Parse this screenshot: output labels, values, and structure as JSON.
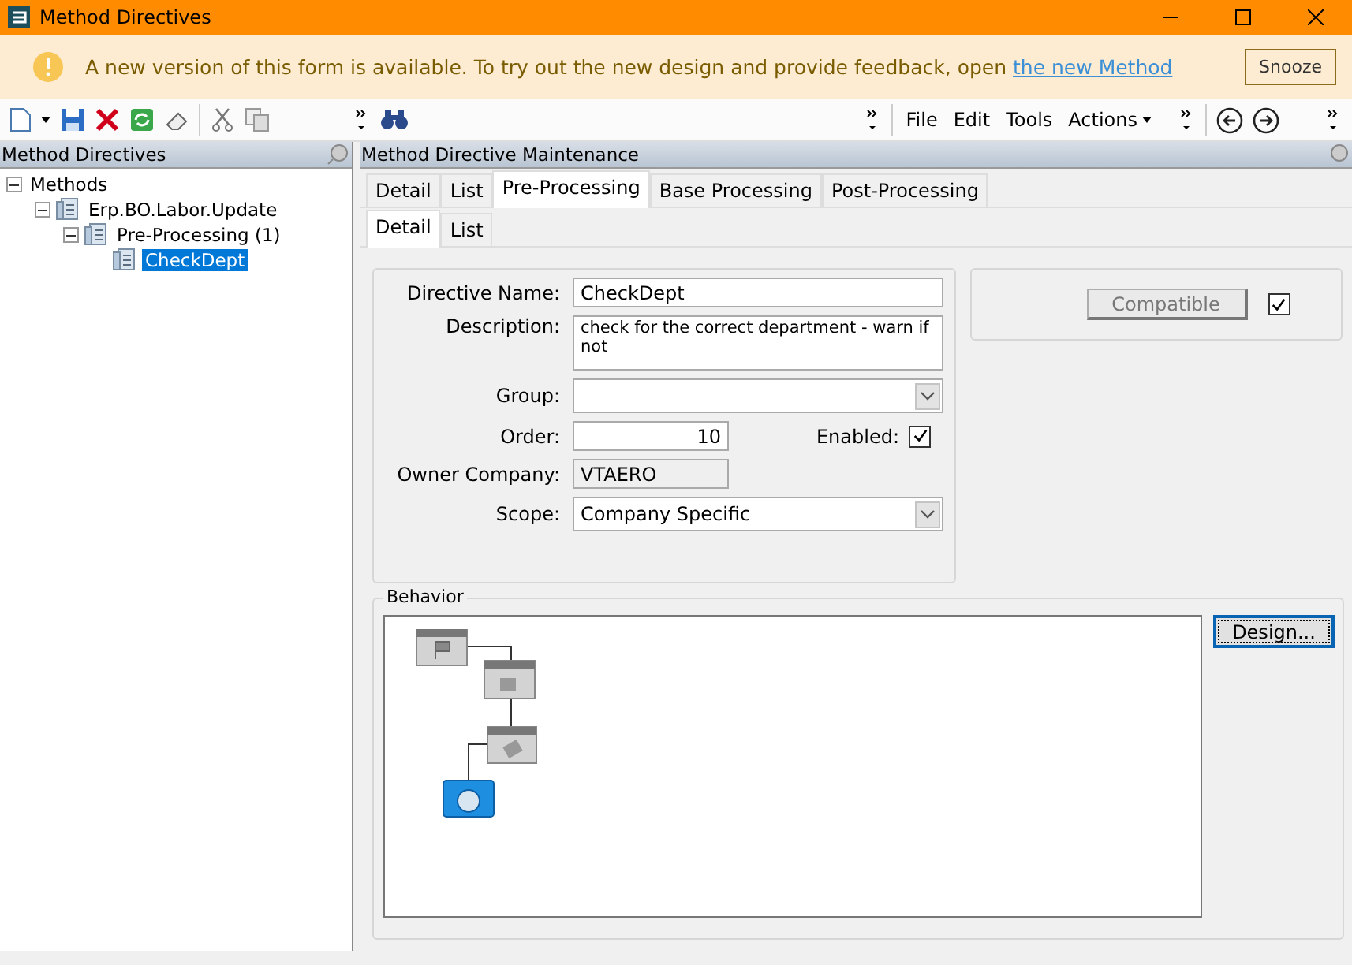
{
  "window": {
    "title": "Method Directives"
  },
  "banner": {
    "message": "A new version of this form is available. To try out the new design and provide feedback, open ",
    "link": "the new Method",
    "button": "Snooze"
  },
  "toolbar": {
    "menus": [
      "File",
      "Edit",
      "Tools",
      "Actions"
    ]
  },
  "tree": {
    "title": "Method Directives",
    "items": [
      {
        "label": "Methods",
        "expanded": true,
        "selected": false,
        "children": [
          {
            "label": "Erp.BO.Labor.Update",
            "expanded": true,
            "selected": false,
            "children": [
              {
                "label": "Pre-Processing (1)",
                "expanded": true,
                "selected": false,
                "children": [
                  {
                    "label": "CheckDept",
                    "selected": true
                  }
                ]
              }
            ]
          }
        ]
      }
    ]
  },
  "main": {
    "title": "Method Directive Maintenance",
    "tabs": [
      {
        "label": "Detail",
        "selected": false
      },
      {
        "label": "List",
        "selected": false
      },
      {
        "label": "Pre-Processing",
        "selected": true
      },
      {
        "label": "Base Processing",
        "selected": false
      },
      {
        "label": "Post-Processing",
        "selected": false
      }
    ],
    "subtabs": [
      {
        "label": "Detail",
        "selected": true
      },
      {
        "label": "List",
        "selected": false
      }
    ],
    "form": {
      "directive_name": {
        "label": "Directive Name:",
        "value": "CheckDept"
      },
      "description": {
        "label": "Description:",
        "value": "check for the correct department - warn if not"
      },
      "group": {
        "label": "Group:"
      },
      "order": {
        "label": "Order:",
        "value": "10"
      },
      "enabled": {
        "label": "Enabled:",
        "checked": true
      },
      "owner_company": {
        "label": "Owner Company:",
        "value": "VTAERO"
      },
      "scope": {
        "label": "Scope:",
        "value": "Company Specific"
      }
    },
    "compatible": {
      "label": "Compatible",
      "checked": true
    },
    "behavior": {
      "title": "Behavior",
      "design_button": "Design..."
    }
  }
}
